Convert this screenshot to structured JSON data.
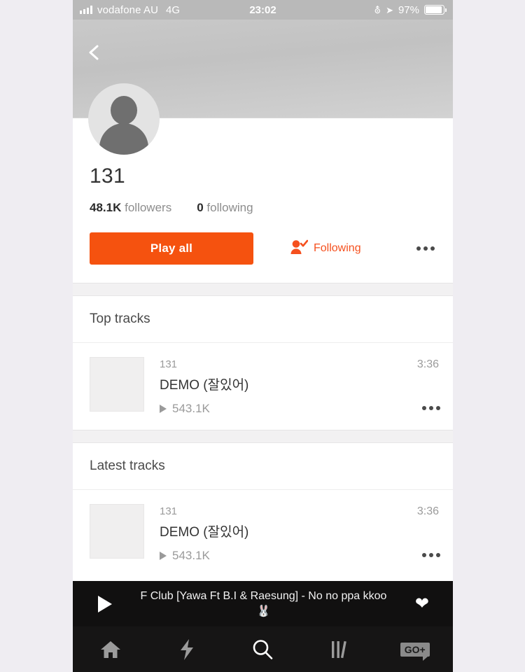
{
  "status_bar": {
    "signal_icon": "signal-bars-icon",
    "carrier": "vodafone AU",
    "network": "4G",
    "time": "23:02",
    "lock_icon": "rotation-lock-icon",
    "location_icon": "location-arrow-icon",
    "battery_percent": "97%",
    "battery_icon": "battery-icon"
  },
  "header": {
    "back_icon": "back-chevron-icon",
    "banner_color": "#c9c9c9"
  },
  "profile": {
    "avatar_icon": "default-avatar-icon",
    "username": "131",
    "followers_count": "48.1K",
    "followers_label": "followers",
    "following_count": "0",
    "following_label": "following",
    "play_all_label": "Play all",
    "following_button_label": "Following",
    "following_icon": "user-check-icon",
    "more_icon": "more-dots-icon",
    "accent_color": "#f5520f"
  },
  "sections": [
    {
      "title": "Top tracks",
      "tracks": [
        {
          "artist": "131",
          "title": "DEMO (잘있어)",
          "plays": "543.1K",
          "duration": "3:36",
          "play_icon": "play-triangle-icon",
          "more_icon": "more-dots-icon",
          "artwork_icon": "track-artwork-placeholder"
        }
      ]
    },
    {
      "title": "Latest tracks",
      "tracks": [
        {
          "artist": "131",
          "title": "DEMO (잘있어)",
          "plays": "543.1K",
          "duration": "3:36",
          "play_icon": "play-triangle-icon",
          "more_icon": "more-dots-icon",
          "artwork_icon": "track-artwork-placeholder"
        }
      ]
    }
  ],
  "player": {
    "play_icon": "play-icon",
    "now_playing_line1": "F Club [Yawa Ft B.I & Raesung] - No no ppa kkoo",
    "now_playing_line2": "🐰",
    "like_icon": "heart-icon"
  },
  "tabbar": {
    "items": [
      {
        "icon": "home-icon",
        "active": false
      },
      {
        "icon": "lightning-bolt-icon",
        "active": false
      },
      {
        "icon": "search-icon",
        "active": true
      },
      {
        "icon": "library-icon",
        "active": false
      },
      {
        "icon": "go-plus-icon",
        "label": "GO+",
        "active": false
      }
    ]
  }
}
